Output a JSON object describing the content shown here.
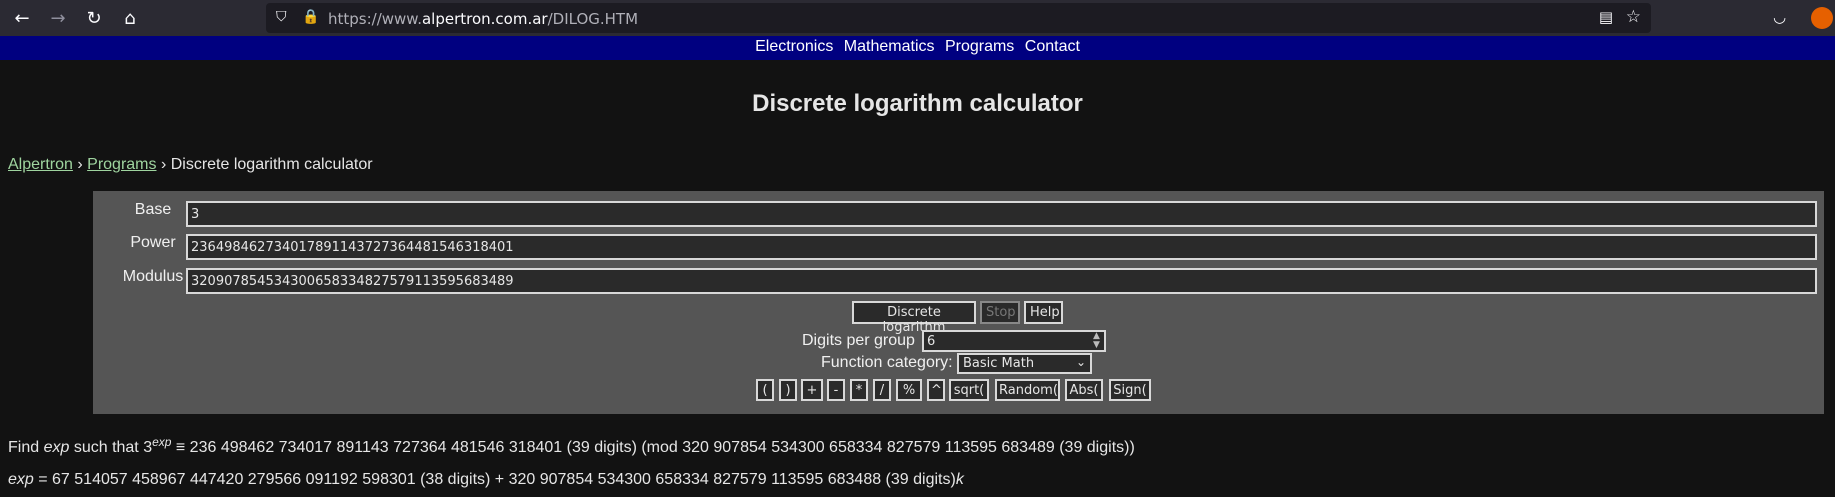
{
  "browser": {
    "url_prefix": "https://www.",
    "url_host": "alpertron.com.ar",
    "url_path": "/DILOG.HTM",
    "back_glyph": "←",
    "forward_glyph": "→",
    "reload_glyph": "↻",
    "home_glyph": "⌂",
    "shield_glyph": "⛉",
    "lock_glyph": "🔒",
    "reader_glyph": "▤",
    "star_glyph": "☆",
    "pocket_glyph": "◡"
  },
  "site_nav": {
    "items": [
      "Electronics",
      "Mathematics",
      "Programs",
      "Contact"
    ]
  },
  "page": {
    "title": "Discrete logarithm calculator"
  },
  "breadcrumb": {
    "home": "Alpertron",
    "sep": " › ",
    "programs": "Programs",
    "current": "Discrete logarithm calculator"
  },
  "calculator": {
    "base_label": "Base",
    "base_value": "3",
    "power_label": "Power",
    "power_value": "236498462734017891143727364481546318401",
    "modulus_label": "Modulus",
    "modulus_value": "320907854534300658334827579113595683489",
    "dlog_button": "Discrete logarithm",
    "stop_button": "Stop",
    "help_button": "Help",
    "digits_per_group_label": "Digits per group",
    "digits_per_group_value": "6",
    "function_category_label": "Function category:",
    "function_category_value": "Basic Math",
    "function_buttons": [
      "(",
      ")",
      "+",
      "-",
      "*",
      "/",
      "%",
      "^",
      "sqrt(",
      "Random(",
      "Abs(",
      "Sign("
    ]
  },
  "result": {
    "line1_find": "Find ",
    "line1_exp": "exp",
    "line1_such": " such that 3",
    "line1_sup": "exp",
    "line1_rest": " ≡ 236 498462 734017 891143 727364 481546 318401 (39 digits) (mod 320 907854 534300 658334 827579 113595 683489 (39 digits))",
    "line2_exp": "exp",
    "line2_rest": " = 67 514057 458967 447420 279566 091192 598301 (38 digits) + 320 907854 534300 658334 827579 113595 683488 (39 digits)",
    "line2_k": "k"
  }
}
